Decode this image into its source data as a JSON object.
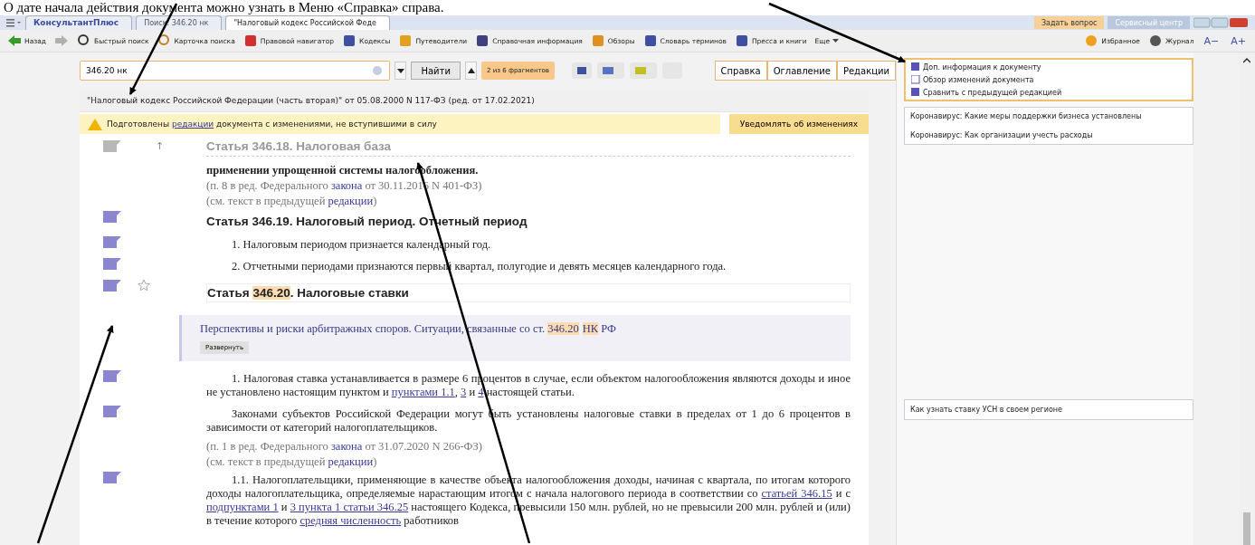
{
  "caption": "О дате начала действия документа можно узнать в Меню «Справка» справа.",
  "tabs": [
    {
      "label": "КонсультантПлюс",
      "selected": false
    },
    {
      "label": "Поиск: 346.20 нк",
      "selected": false
    },
    {
      "label": "\"Налоговый кодекс Российской Феде",
      "selected": true
    }
  ],
  "top_buttons": [
    "Задать вопрос",
    "Сервисный центр"
  ],
  "toolbar": [
    "Назад",
    "Быстрый поиск",
    "Карточка поиска",
    "Правовой навигатор",
    "Кодексы",
    "Путеводители",
    "Справочная информация",
    "Обзоры",
    "Словарь терминов",
    "Пресса и книги",
    "Еще"
  ],
  "toolbar_right": [
    "Избранное",
    "Журнал"
  ],
  "font_buttons": [
    "A−",
    "A+"
  ],
  "search": {
    "value": "346.20 нк",
    "find_button": "Найти",
    "fragments": "2 из 6 фрагментов"
  },
  "panel_tabs": [
    "Справка",
    "Оглавление",
    "Редакции"
  ],
  "document": {
    "title": "\"Налоговый кодекс Российской Федерации (часть вторая)\" от 05.08.2000 N 117-ФЗ (ред. от 17.02.2021)",
    "notice": [
      {
        "kind": "plain",
        "t": "Подготовлены "
      },
      {
        "kind": "link",
        "t": "редакции"
      },
      {
        "kind": "plain",
        "t": " документа с изменениями, не вступившими в силу"
      }
    ],
    "notify_button": "Уведомлять об изменениях",
    "blocks": [
      {
        "kind": "faded_heading",
        "marker": "↑",
        "parts": [
          {
            "kind": "plain",
            "t": "Статья 346.18. Налоговая база"
          }
        ]
      },
      {
        "kind": "bold_text",
        "parts": [
          {
            "kind": "plain",
            "t": "применении упрощенной системы налогообложения."
          }
        ]
      },
      {
        "kind": "note",
        "parts": [
          {
            "kind": "plain",
            "t": "(п. 8 в ред. Федерального "
          },
          {
            "kind": "link",
            "t": "закона"
          },
          {
            "kind": "plain",
            "t": " от 30.11.2016 N 401-ФЗ)"
          }
        ]
      },
      {
        "kind": "note",
        "parts": [
          {
            "kind": "plain",
            "t": "(см. текст в предыдущей "
          },
          {
            "kind": "link",
            "t": "редакции"
          },
          {
            "kind": "plain",
            "t": ")"
          }
        ]
      },
      {
        "kind": "heading",
        "parts": [
          {
            "kind": "plain",
            "t": "Статья 346.19. Налоговый период. Отчетный период"
          }
        ]
      },
      {
        "kind": "text",
        "parts": [
          {
            "kind": "plain",
            "t": "1. Налоговым периодом признается календарный год."
          }
        ]
      },
      {
        "kind": "text",
        "parts": [
          {
            "kind": "plain",
            "t": "2. Отчетными периодами признаются первый квартал, полугодие и девять месяцев календарного года."
          }
        ]
      },
      {
        "kind": "star_heading",
        "parts": [
          {
            "kind": "plain",
            "t": "Статья "
          },
          {
            "kind": "highlight",
            "t": "346.20"
          },
          {
            "kind": "plain",
            "t": ". Налоговые ставки"
          }
        ]
      },
      {
        "kind": "related",
        "button": "Развернуть",
        "parts": [
          {
            "kind": "plain",
            "t": "Перспективы и риски арбитражных споров. Ситуации, связанные со ст. "
          },
          {
            "kind": "highlight",
            "t": "346.20"
          },
          {
            "kind": "highlight",
            "t": "НК"
          },
          {
            "kind": "plain",
            "t": " РФ"
          }
        ]
      },
      {
        "kind": "text",
        "parts": [
          {
            "kind": "plain",
            "t": "1. Налоговая ставка устанавливается в размере 6 процентов в случае, если объектом налогообложения являются доходы и иное не установлено настоящим пунктом и "
          },
          {
            "kind": "link",
            "t": "пунктами 1.1"
          },
          {
            "kind": "plain",
            "t": ", "
          },
          {
            "kind": "link",
            "t": "3"
          },
          {
            "kind": "plain",
            "t": " и "
          },
          {
            "kind": "link",
            "t": "4"
          },
          {
            "kind": "plain",
            "t": " настоящей статьи."
          }
        ]
      },
      {
        "kind": "text",
        "parts": [
          {
            "kind": "plain",
            "t": "Законами субъектов Российской Федерации могут быть установлены налоговые ставки в пределах от 1 до 6 процентов в зависимости от категорий налогоплательщиков."
          }
        ]
      },
      {
        "kind": "note",
        "parts": [
          {
            "kind": "plain",
            "t": "(п. 1 в ред. Федерального "
          },
          {
            "kind": "link",
            "t": "закона"
          },
          {
            "kind": "plain",
            "t": " от 31.07.2020 N 266-ФЗ)"
          }
        ]
      },
      {
        "kind": "note",
        "parts": [
          {
            "kind": "plain",
            "t": "(см. текст в предыдущей "
          },
          {
            "kind": "link",
            "t": "редакции"
          },
          {
            "kind": "plain",
            "t": ")"
          }
        ]
      },
      {
        "kind": "text",
        "parts": [
          {
            "kind": "plain",
            "t": "1.1. Налогоплательщики, применяющие в качестве объекта налогообложения доходы, начиная с квартала, по итогам которого доходы налогоплательщика, определяемые нарастающим итогом с начала налогового периода в соответствии со "
          },
          {
            "kind": "link",
            "t": "статьей 346.15"
          },
          {
            "kind": "plain",
            "t": " и с "
          },
          {
            "kind": "link",
            "t": "подпунктами 1"
          },
          {
            "kind": "plain",
            "t": " и "
          },
          {
            "kind": "link",
            "t": "3 пункта 1 статьи 346.25"
          },
          {
            "kind": "plain",
            "t": "  настоящего Кодекса, превысили 150 млн. рублей, но не превысили 200 млн. рублей и (или) в течение которого "
          },
          {
            "kind": "link",
            "t": "средняя численность"
          },
          {
            "kind": "plain",
            "t": " работников"
          }
        ]
      }
    ]
  },
  "info_links": [
    "Доп. информация к документу",
    "Обзор изменений документа",
    "Сравнить с предыдущей редакцией"
  ],
  "news": [
    "Коронавирус: Какие меры поддержки бизнеса установлены",
    "Коронавирус: Как организации учесть расходы"
  ],
  "tip": "Как узнать ставку УСН в своем регионе"
}
